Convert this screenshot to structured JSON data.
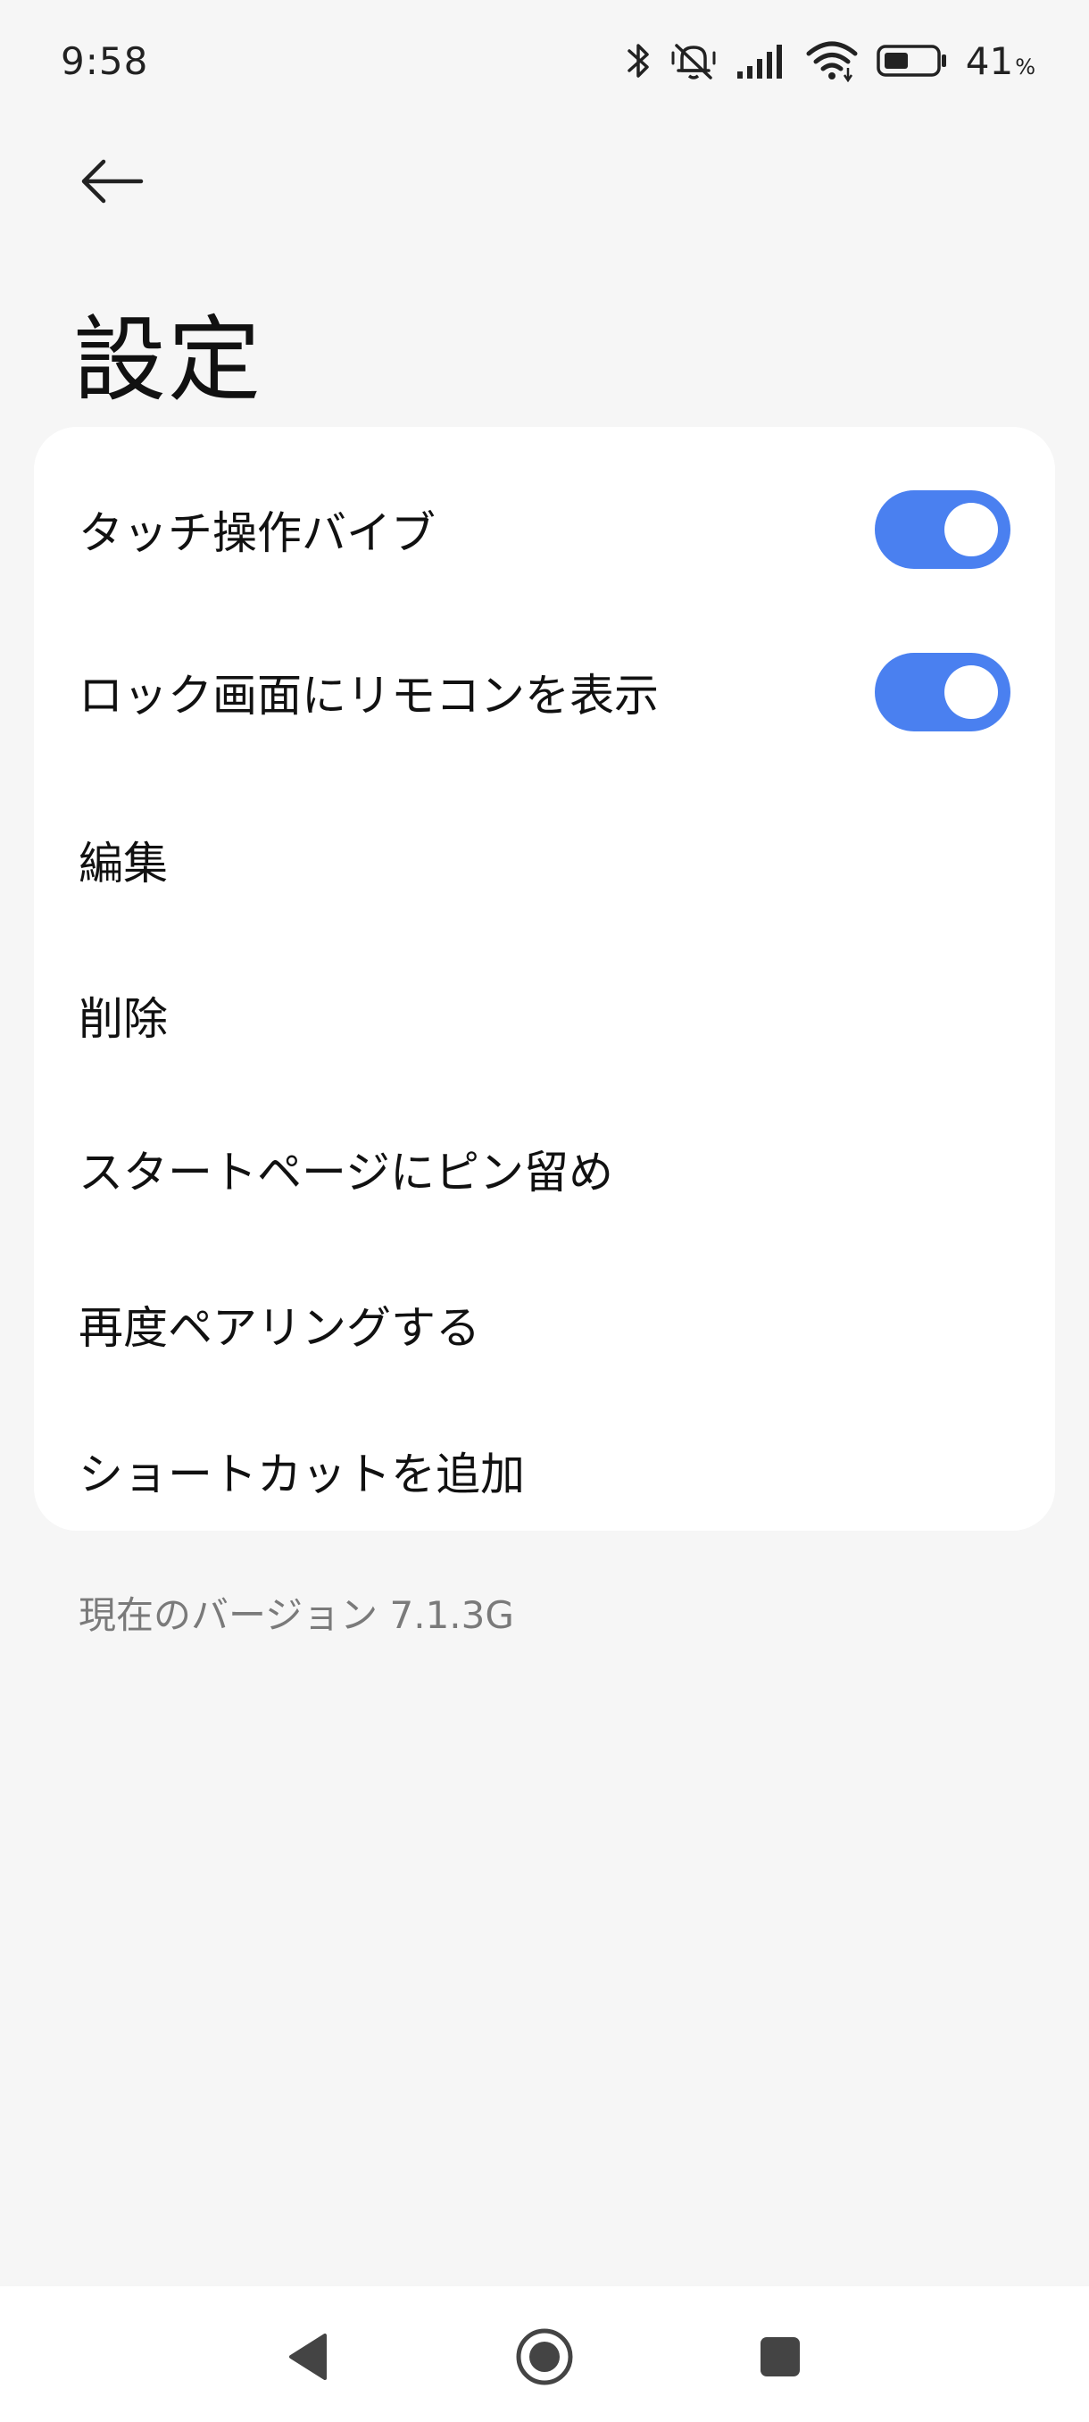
{
  "status_bar": {
    "time": "9:58",
    "battery_percent": "41",
    "battery_percent_sign": "%",
    "icons": [
      "bluetooth-icon",
      "silent-icon",
      "signal-icon",
      "wifi-icon",
      "battery-icon"
    ]
  },
  "header": {
    "back_icon": "back-arrow-icon",
    "title": "設定"
  },
  "settings": {
    "items": [
      {
        "label": "タッチ操作バイブ",
        "type": "toggle",
        "checked": true
      },
      {
        "label": "ロック画面にリモコンを表示",
        "type": "toggle",
        "checked": true
      },
      {
        "label": "編集",
        "type": "action"
      },
      {
        "label": "削除",
        "type": "action"
      },
      {
        "label": "スタートページにピン留め",
        "type": "action"
      },
      {
        "label": "再度ペアリングする",
        "type": "action"
      },
      {
        "label": "ショートカットを追加",
        "type": "action"
      }
    ]
  },
  "footer": {
    "version_text": "現在のバージョン 7.1.3G"
  },
  "nav_bar": {
    "buttons": [
      "nav-back-icon",
      "nav-home-icon",
      "nav-recents-icon"
    ]
  },
  "colors": {
    "background": "#f6f6f6",
    "card": "#ffffff",
    "accent": "#4a80f0",
    "text": "#111111",
    "secondary_text": "#7a7a7a"
  }
}
